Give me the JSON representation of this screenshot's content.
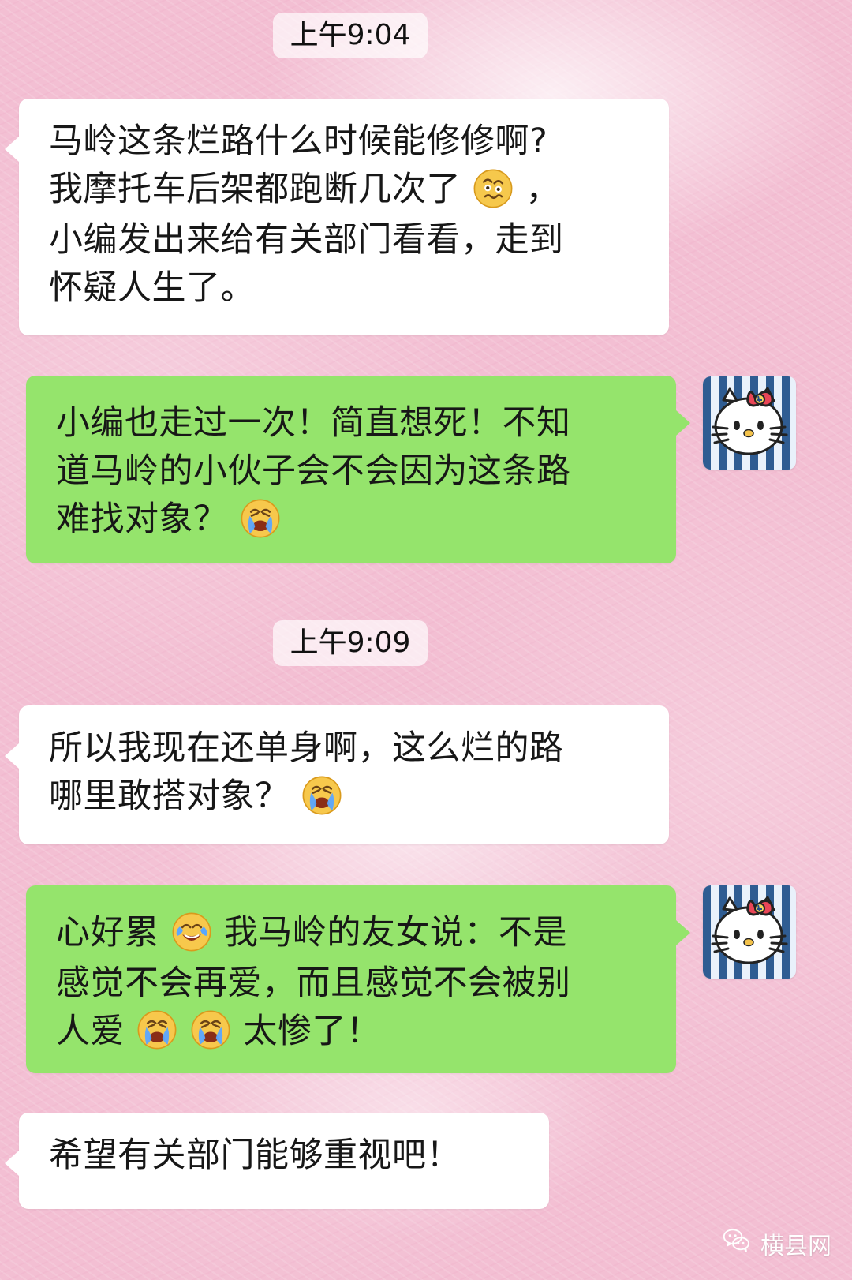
{
  "chat": {
    "timestamp_1": "上午9:04",
    "timestamp_2": "上午9:09",
    "message_1": {
      "line_1": "马岭这条烂路什么时候能修修啊?",
      "line_2_before_emoji": "我摩托车后架都跑断几次了",
      "line_2_after_emoji": "，",
      "line_3": "小编发出来给有关部门看看，走到",
      "line_4": "怀疑人生了。"
    },
    "message_2": {
      "line_1": "小编也走过一次！简直想死！不知",
      "line_2": "道马岭的小伙子会不会因为这条路",
      "line_3_before_emoji": "难找对象？"
    },
    "message_3": {
      "line_1": "所以我现在还单身啊，这么烂的路",
      "line_2_before_emoji": "哪里敢搭对象？"
    },
    "message_4": {
      "line_1_before_emoji": "心好累",
      "line_1_after_emoji": "我马岭的友女说：不是",
      "line_2": "感觉不会再爱，而且感觉不会被别",
      "line_3_before_emojis": "人爱",
      "line_3_after_emojis": "太惨了！"
    },
    "message_5": {
      "line_1": "希望有关部门能够重视吧！"
    }
  },
  "icons": {
    "woozy": "woozy-face-icon",
    "loudly_crying": "loudly-crying-face-icon",
    "tears_of_joy": "face-with-tears-of-joy-icon",
    "avatar": "hello-kitty-avatar-icon",
    "wechat": "wechat-icon"
  },
  "watermark": {
    "text": "横县网"
  },
  "colors": {
    "background": "#f3bfd3",
    "incoming_bubble": "#ffffff",
    "outgoing_bubble": "#95e46c"
  }
}
